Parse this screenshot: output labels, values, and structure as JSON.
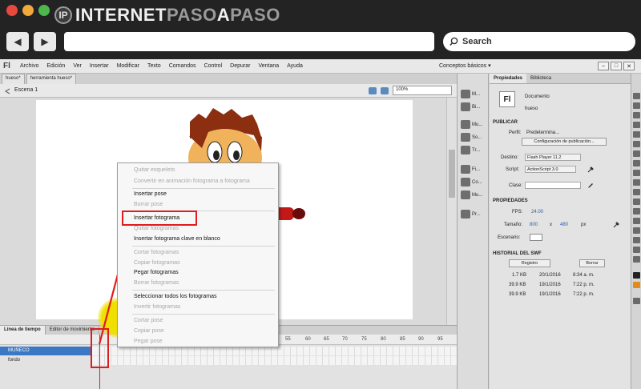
{
  "browser": {
    "logo_mark": "IP",
    "logo_part1": "INTERNET",
    "logo_part2": "PASO",
    "logo_part3": "A",
    "logo_part4": "PASO",
    "back_icon": "◀",
    "forward_icon": "▶",
    "search_label": "Search"
  },
  "app": {
    "logo": "Fl",
    "menu": [
      "Archivo",
      "Edición",
      "Ver",
      "Insertar",
      "Modificar",
      "Texto",
      "Comandos",
      "Control",
      "Depurar",
      "Ventana",
      "Ayuda"
    ],
    "workspace": "Conceptos básicos ▾",
    "doc_tabs": [
      "hueso*",
      "herramienta hueso*"
    ],
    "scene": "Escena 1",
    "zoom": "100%"
  },
  "timeline": {
    "tabs": [
      "Línea de tiempo",
      "Editor de movimiento"
    ],
    "frame_numbers": [
      "55",
      "60",
      "65",
      "70",
      "75",
      "80",
      "85",
      "90",
      "95"
    ],
    "layers": [
      "MUÑECO",
      "fondo"
    ]
  },
  "context_menu": {
    "items": [
      {
        "label": "Quitar esqueleto",
        "disabled": true
      },
      {
        "label": "Convertir en animación fotograma a fotograma",
        "disabled": true
      },
      {
        "label": "Insertar pose",
        "disabled": false
      },
      {
        "label": "Borrar pose",
        "disabled": true
      },
      {
        "label": "Insertar fotograma",
        "disabled": false
      },
      {
        "label": "Quitar fotogramas",
        "disabled": true
      },
      {
        "label": "Insertar fotograma clave en blanco",
        "disabled": false
      },
      {
        "label": "Cortar fotogramas",
        "disabled": true
      },
      {
        "label": "Copiar fotogramas",
        "disabled": true
      },
      {
        "label": "Pegar fotogramas",
        "disabled": false
      },
      {
        "label": "Borrar fotogramas",
        "disabled": true
      },
      {
        "label": "Seleccionar todos los fotogramas",
        "disabled": false
      },
      {
        "label": "Invertir fotogramas",
        "disabled": true
      },
      {
        "label": "Cortar pose",
        "disabled": true
      },
      {
        "label": "Copiar pose",
        "disabled": true
      },
      {
        "label": "Pegar pose",
        "disabled": true
      }
    ],
    "highlighted": "Insertar fotograma"
  },
  "tool_panel": [
    "M...",
    "Bi...",
    "Mu...",
    "So...",
    "Tr...",
    "Fi...",
    "Co...",
    "Mu...",
    "Pr..."
  ],
  "properties": {
    "tabs": [
      "Propiedades",
      "Biblioteca"
    ],
    "doc_type": "Documento",
    "doc_name": "hueso",
    "doc_icon": "Fl",
    "publish_header": "PUBLICAR",
    "profile_label": "Perfil:",
    "profile_value": "Predetermina...",
    "publish_settings_btn": "Configuración de publicación...",
    "target_label": "Destino:",
    "target_value": "Flash Player 11.2",
    "script_label": "Script:",
    "script_value": "ActionScript 3.0",
    "class_label": "Clase:",
    "props_header": "PROPIEDADES",
    "fps_label": "FPS:",
    "fps_value": "24.00",
    "size_label": "Tamaño:",
    "size_w": "800",
    "size_x": "x",
    "size_h": "480",
    "size_unit": "px",
    "stage_label": "Escenario:",
    "history_header": "HISTORIAL DEL SWF",
    "log_btn": "Registro",
    "clear_btn": "Borrar",
    "history": [
      {
        "size": "1.7 KB",
        "date": "20/1/2016",
        "time": "8:34 a. m."
      },
      {
        "size": "39.9 KB",
        "date": "19/1/2016",
        "time": "7:22 p. m."
      },
      {
        "size": "39.9 KB",
        "date": "19/1/2016",
        "time": "7:22 p. m."
      }
    ]
  },
  "colors": {
    "highlight": "#e01c1c",
    "selected_layer": "#3a78c3",
    "cursor_halo": "#f0e000"
  }
}
